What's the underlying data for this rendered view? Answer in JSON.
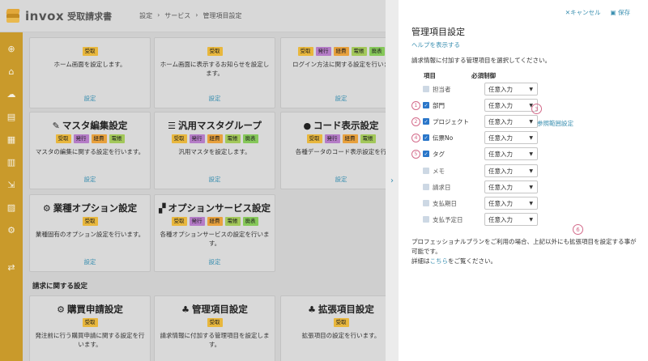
{
  "app": {
    "logo_text": "invox",
    "logo_sub": "受取請求書"
  },
  "breadcrumb": [
    "設定",
    "›",
    "サービス",
    "›",
    "管理項目設定"
  ],
  "rail_icons": [
    "plus-icon",
    "home-icon",
    "cloud-upload-icon",
    "document-icon",
    "document-list-icon",
    "building-icon",
    "document-export-icon",
    "chart-icon",
    "gear-icon",
    "link-icon"
  ],
  "rail_glyphs": [
    "⊕",
    "⌂",
    "☁",
    "▤",
    "▦",
    "▥",
    "⇲",
    "▨",
    "⚙",
    "⇄"
  ],
  "cards": [
    {
      "title": "",
      "tags": [
        "受取"
      ],
      "desc": "ホーム画面を設定します。",
      "link": "設定"
    },
    {
      "title": "",
      "tags": [
        "受取"
      ],
      "desc": "ホーム画面に表示するお知らせを設定します。",
      "link": "設定"
    },
    {
      "title": "",
      "tags": [
        "受取",
        "発行",
        "経費",
        "電帳",
        "廃表"
      ],
      "desc": "ログイン方法に関する設定を行いま",
      "link": "設定"
    },
    {
      "title": "マスタ編集設定",
      "icon": "✎",
      "tags": [
        "受取",
        "発行",
        "経費",
        "電帳"
      ],
      "desc": "マスタの編集に関する設定を行います。",
      "link": "設定"
    },
    {
      "title": "汎用マスタグループ",
      "icon": "☰",
      "tags": [
        "受取",
        "発行",
        "経費",
        "電帳",
        "廃表"
      ],
      "desc": "汎用マスタを設定します。",
      "link": "設定"
    },
    {
      "title": "コード表示設定",
      "icon": "●",
      "tags": [
        "受取",
        "発行",
        "経費",
        "電帳"
      ],
      "desc": "各種データのコード表示設定を行",
      "link": "設定"
    },
    {
      "title": "業種オプション設定",
      "icon": "⚙",
      "tags": [
        "受取"
      ],
      "desc": "業種固有のオプション設定を行います。",
      "link": "設定"
    },
    {
      "title": "オプションサービス設定",
      "icon": "▞",
      "tags": [
        "受取",
        "発行",
        "経費",
        "電帳",
        "廃表"
      ],
      "desc": "各種オプションサービスの設定を行います。",
      "link": "設定"
    },
    {
      "title": "購買申請設定",
      "icon": "⚙",
      "tags": [
        "受取"
      ],
      "desc": "発注前に行う購買申請に関する設定を行います。",
      "link": ""
    },
    {
      "title": "管理項目設定",
      "icon": "♣",
      "tags": [
        "受取"
      ],
      "desc": "請求情報に付加する管理項目を設定します。",
      "link": ""
    },
    {
      "title": "拡張項目設定",
      "icon": "♣",
      "tags": [
        "受取"
      ],
      "desc": "拡張項目の設定を行います。",
      "link": ""
    }
  ],
  "section_invoice": "請求に関する設定",
  "panel": {
    "cancel": "✕キャンセル",
    "save": "保存",
    "title": "管理項目設定",
    "help": "ヘルプを表示する",
    "desc": "請求情報に付加する管理項目を選択してください。",
    "col_item": "項目",
    "col_control": "必須制御",
    "scope_link": "参照範囲設定",
    "rows": [
      {
        "num": "",
        "label": "担当者",
        "checked": false,
        "control": "任意入力"
      },
      {
        "num": "1",
        "label": "部門",
        "checked": true,
        "control": "任意入力"
      },
      {
        "num": "2",
        "label": "プロジェクト",
        "checked": true,
        "control": "任意入力"
      },
      {
        "num": "4",
        "label": "伝票No",
        "checked": true,
        "control": "任意入力"
      },
      {
        "num": "5",
        "label": "タグ",
        "checked": true,
        "control": "任意入力"
      },
      {
        "num": "",
        "label": "メモ",
        "checked": false,
        "control": "任意入力"
      },
      {
        "num": "",
        "label": "請求日",
        "checked": false,
        "control": "任意入力"
      },
      {
        "num": "",
        "label": "支払期日",
        "checked": false,
        "control": "任意入力"
      },
      {
        "num": "",
        "label": "支払予定日",
        "checked": false,
        "control": "任意入力"
      }
    ],
    "annotation_3": "3",
    "annotation_6": "6",
    "footer_line1": "プロフェッショナルプランをご利用の場合、上記以外にも拡張項目を設定する事が可能です。",
    "footer_prefix": "詳細は",
    "footer_link": "こちら",
    "footer_suffix": "をご覧ください。"
  },
  "panel_toggle": "›",
  "colors": {
    "accent": "#3a8fb0",
    "rail": "#c99a2b",
    "checkbox": "#2a76c9",
    "annotation": "#d36a8a"
  }
}
